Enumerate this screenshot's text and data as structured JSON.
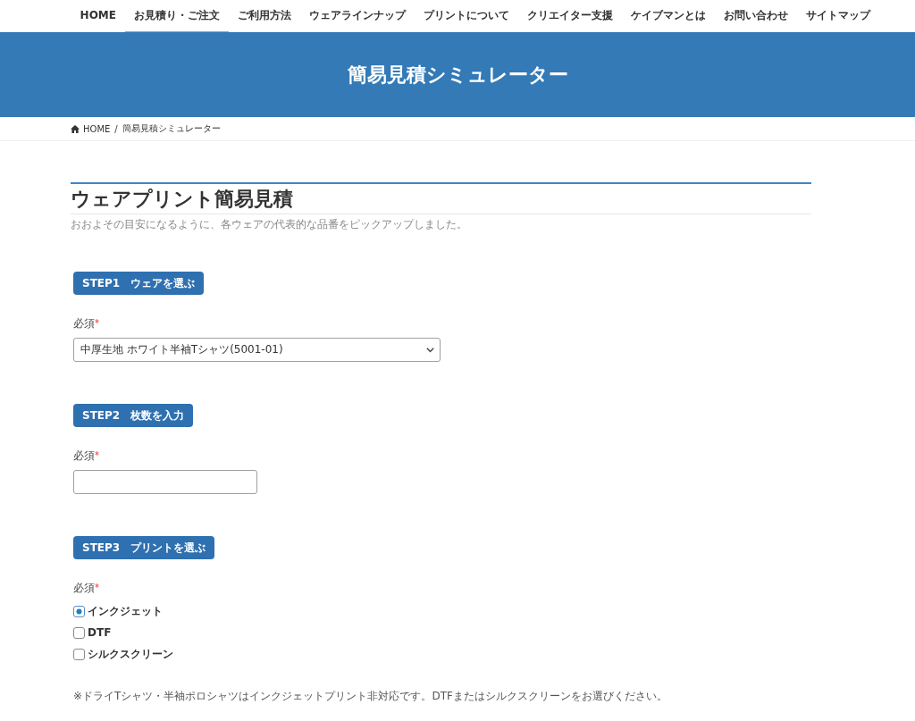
{
  "nav": {
    "items": [
      {
        "label": "HOME",
        "selected": false
      },
      {
        "label": "お見積り・ご注文",
        "selected": true
      },
      {
        "label": "ご利用方法",
        "selected": false
      },
      {
        "label": "ウェアラインナップ",
        "selected": false
      },
      {
        "label": "プリントについて",
        "selected": false
      },
      {
        "label": "クリエイター支援",
        "selected": false
      },
      {
        "label": "ケイブマンとは",
        "selected": false
      },
      {
        "label": "お問い合わせ",
        "selected": false
      },
      {
        "label": "サイトマップ",
        "selected": false
      }
    ]
  },
  "banner": {
    "title": "簡易見積シミュレーター"
  },
  "breadcrumb": {
    "separator": "/",
    "items": [
      {
        "label": "HOME",
        "kind": "home"
      },
      {
        "label": "簡易見積シミュレーター",
        "kind": "current"
      }
    ]
  },
  "heading": {
    "title": "ウェアプリント簡易見積",
    "subtitle": "おおよその目安になるように、各ウェアの代表的な品番をピックアップしました。"
  },
  "steps": [
    {
      "badge": "STEP1　ウェアを選ぶ",
      "label": "必須",
      "required_mark": "*",
      "kind": "select",
      "value": "中厚生地 ホワイト半袖Tシャツ(5001-01)"
    },
    {
      "badge": "STEP2　枚数を入力",
      "label": "必須",
      "required_mark": "*",
      "kind": "text"
    },
    {
      "badge": "STEP3　プリントを選ぶ",
      "label": "必須",
      "required_mark": "*",
      "kind": "choice",
      "options": [
        {
          "label": "インクジェット",
          "selected": true
        },
        {
          "label": "DTF",
          "selected": false
        },
        {
          "label": "シルクスクリーン",
          "selected": false
        }
      ]
    }
  ],
  "note": "※ドライTシャツ・半袖ポロシャツはインクジェットプリント非対応です。DTFまたはシルクスクリーンをお選びください。"
}
